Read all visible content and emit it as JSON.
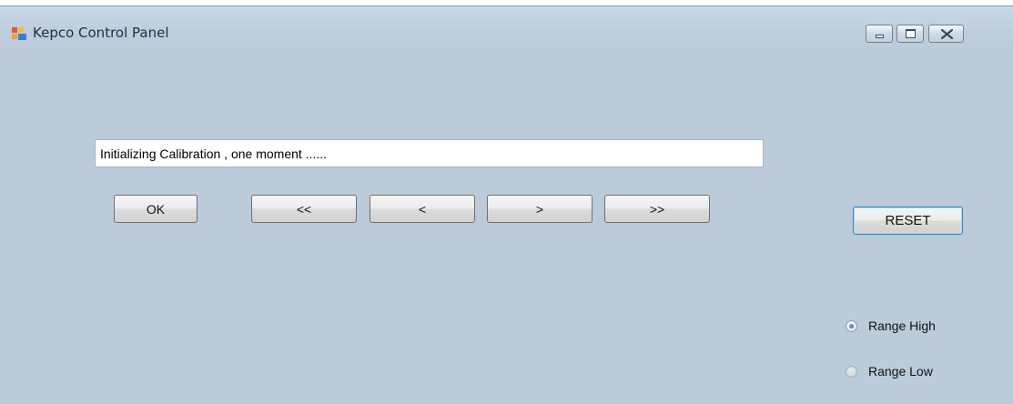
{
  "window": {
    "title": "Kepco Control Panel"
  },
  "status": {
    "text": "Initializing Calibration , one moment ......"
  },
  "buttons": {
    "ok": "OK",
    "first": "<<",
    "prev": "<",
    "next": ">",
    "last": ">>",
    "reset": "RESET"
  },
  "range": {
    "high_label": "Range High",
    "low_label": "Range Low",
    "selected": "Range High"
  },
  "icons": {
    "app": "app-window-icon",
    "minimize": "minimize-icon",
    "maximize": "maximize-icon",
    "close": "close-icon"
  },
  "colors": {
    "window_background": "#bccbd9",
    "reset_focus_border": "#3c7fb1",
    "radio_selected": "#1f5f9c"
  }
}
